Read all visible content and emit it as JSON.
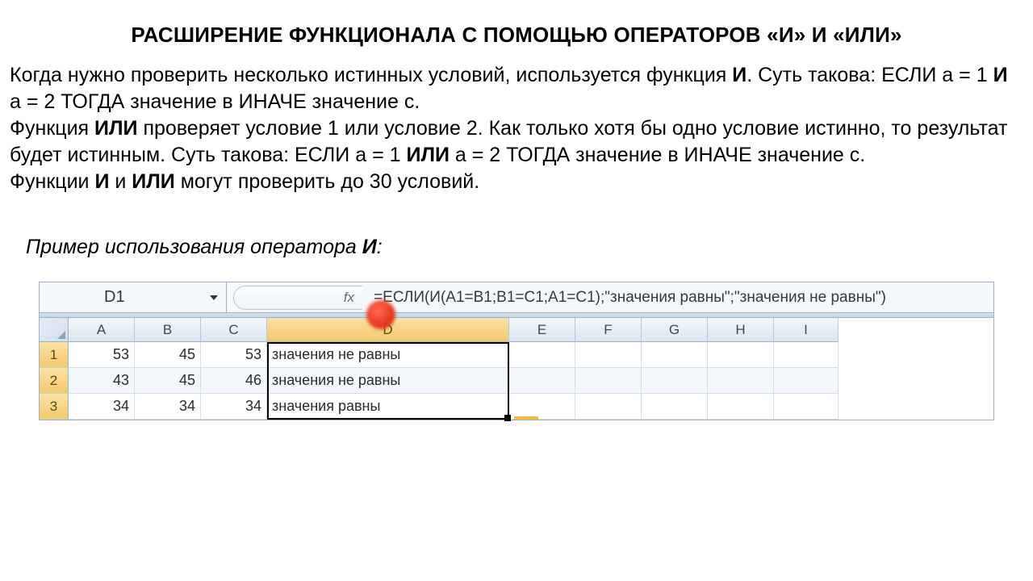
{
  "title": "РАСШИРЕНИЕ ФУНКЦИОНАЛА С ПОМОЩЬЮ ОПЕРАТОРОВ «И» И «ИЛИ»",
  "paragraph": {
    "t1": "Когда нужно проверить несколько истинных условий, используется функция ",
    "b1": "И",
    "t2": ". Суть такова: ЕСЛИ а = 1 ",
    "b2": "И",
    "t3": " а = 2 ТОГДА значение в ИНАЧЕ значение с.",
    "t4": "Функция ",
    "b3": "ИЛИ",
    "t5": " проверяет условие 1 или условие 2. Как только хотя бы одно условие истинно, то результат будет истинным. Суть такова: ЕСЛИ а = 1 ",
    "b4": "ИЛИ",
    "t6": " а = 2 ТОГДА значение в ИНАЧЕ значение с.",
    "t7": "Функции ",
    "b5": "И",
    "t8": " и ",
    "b6": "ИЛИ",
    "t9": " могут проверить до 30 условий."
  },
  "example_caption_pre": "Пример использования оператора ",
  "example_caption_bold": "И",
  "example_caption_post": ":",
  "excel": {
    "namebox": "D1",
    "fx_label": "fx",
    "formula": "=ЕСЛИ(И(A1=B1;B1=C1;A1=C1);\"значения равны\";\"значения не равны\")",
    "col_headers": [
      "A",
      "B",
      "C",
      "D",
      "E",
      "F",
      "G",
      "H",
      "I"
    ],
    "row_headers": [
      "1",
      "2",
      "3"
    ],
    "rows": [
      {
        "A": "53",
        "B": "45",
        "C": "53",
        "D": "значения не равны"
      },
      {
        "A": "43",
        "B": "45",
        "C": "46",
        "D": "значения не равны"
      },
      {
        "A": "34",
        "B": "34",
        "C": "34",
        "D": "значения равны"
      }
    ]
  }
}
